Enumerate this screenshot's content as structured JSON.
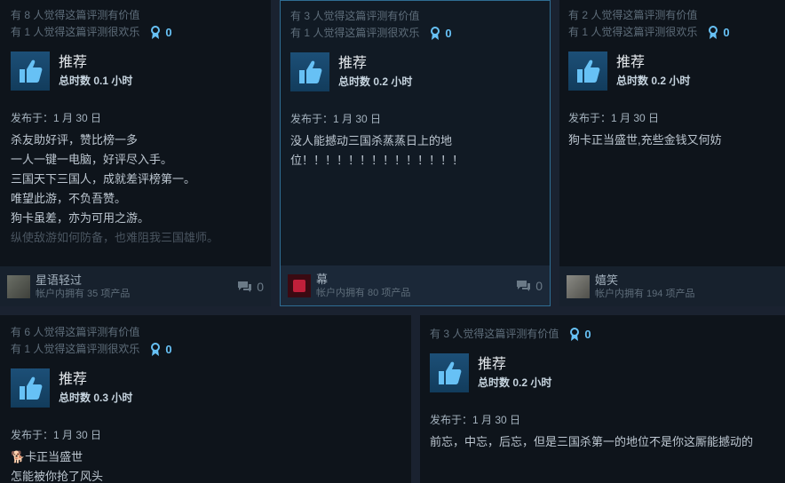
{
  "reviews": [
    {
      "helpful": "有 8 人觉得这篇评测有价值",
      "funny": "有 1 人觉得这篇评测很欢乐",
      "awards": "0",
      "rec": "推荐",
      "hours": "总时数 0.1 小时",
      "posted": "发布于：1 月 30 日",
      "lines": [
        "杀友助好评，赞比榜一多",
        "一人一键一电脑，好评尽入手。",
        "三国天下三国人，成就差评榜第一。",
        "唯望此游，不负吾赞。",
        "狗卡虽差，亦为可用之游。",
        "纵使敌游如何防备，也难阻我三国雄师。"
      ],
      "user": "星语轻过",
      "owned": "帐户内拥有 35 项产品",
      "comments": "0"
    },
    {
      "helpful": "有 3 人觉得这篇评测有价值",
      "funny": "有 1 人觉得这篇评测很欢乐",
      "awards": "0",
      "rec": "推荐",
      "hours": "总时数 0.2 小时",
      "posted": "发布于：1 月 30 日",
      "lines": [
        "没人能撼动三国杀蒸蒸日上的地",
        "位！！！！！！！！！！！！！！"
      ],
      "user": "幕",
      "owned": "帐户内拥有 80 项产品",
      "comments": "0"
    },
    {
      "helpful": "有 2 人觉得这篇评测有价值",
      "funny": "有 1 人觉得这篇评测很欢乐",
      "awards": "0",
      "rec": "推荐",
      "hours": "总时数 0.2 小时",
      "posted": "发布于：1 月 30 日",
      "lines": [
        "狗卡正当盛世,充些金钱又何妨"
      ],
      "user": "嬉笑",
      "owned": "帐户内拥有 194 项产品"
    },
    {
      "helpful": "有 6 人觉得这篇评测有价值",
      "funny": "有 1 人觉得这篇评测很欢乐",
      "awards": "0",
      "rec": "推荐",
      "hours": "总时数 0.3 小时",
      "posted": "发布于：1 月 30 日",
      "lines": [
        "🐕卡正当盛世",
        "怎能被你抢了风头"
      ]
    },
    {
      "helpful": "有 3 人觉得这篇评测有价值",
      "awards": "0",
      "rec": "推荐",
      "hours": "总时数 0.2 小时",
      "posted": "发布于：1 月 30 日",
      "lines": [
        "前忘，中忘，后忘，但是三国杀第一的地位不是你这厮能撼动的"
      ]
    }
  ],
  "colors": {
    "accent": "#67c1f5",
    "highlight_border": "#2f6d93"
  },
  "icons": {
    "thumb": "thumbs-up-icon",
    "award": "award-ribbon-icon",
    "comment": "comment-bubble-icon"
  }
}
